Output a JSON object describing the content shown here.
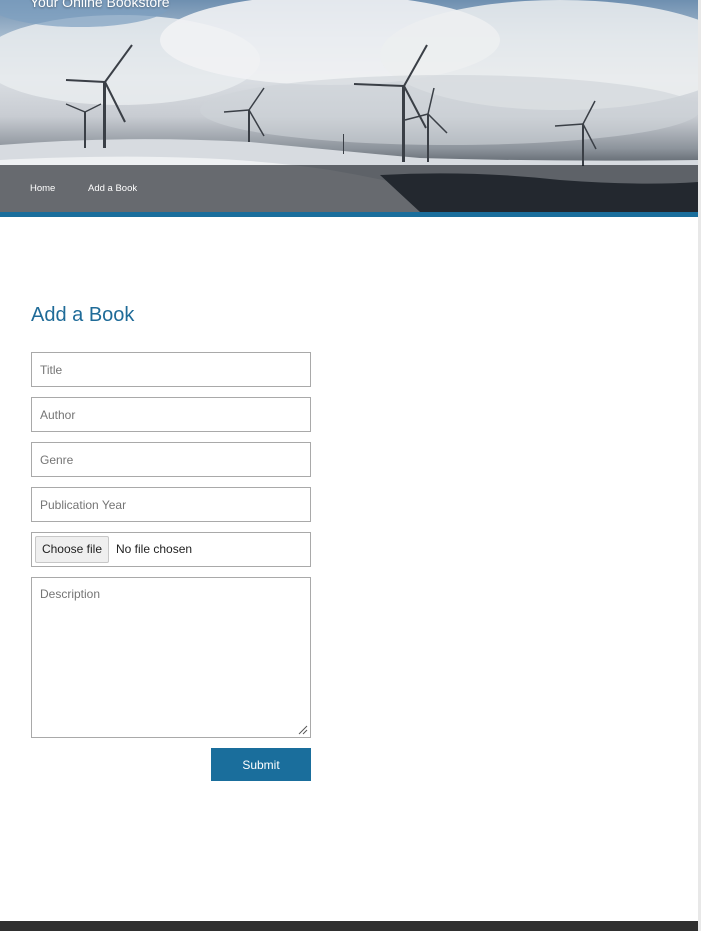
{
  "header": {
    "site_title": "Your Online Bookstore",
    "nav": [
      {
        "label": "Home"
      },
      {
        "label": "Add a Book"
      }
    ]
  },
  "main": {
    "title": "Add a Book",
    "form": {
      "title_placeholder": "Title",
      "author_placeholder": "Author",
      "genre_placeholder": "Genre",
      "year_placeholder": "Publication Year",
      "file_button_label": "Choose file",
      "file_status": "No file chosen",
      "description_placeholder": "Description",
      "submit_label": "Submit"
    }
  },
  "colors": {
    "accent": "#1a6e9c",
    "title_color": "#1f6b98",
    "footer": "#2f2f2f"
  }
}
